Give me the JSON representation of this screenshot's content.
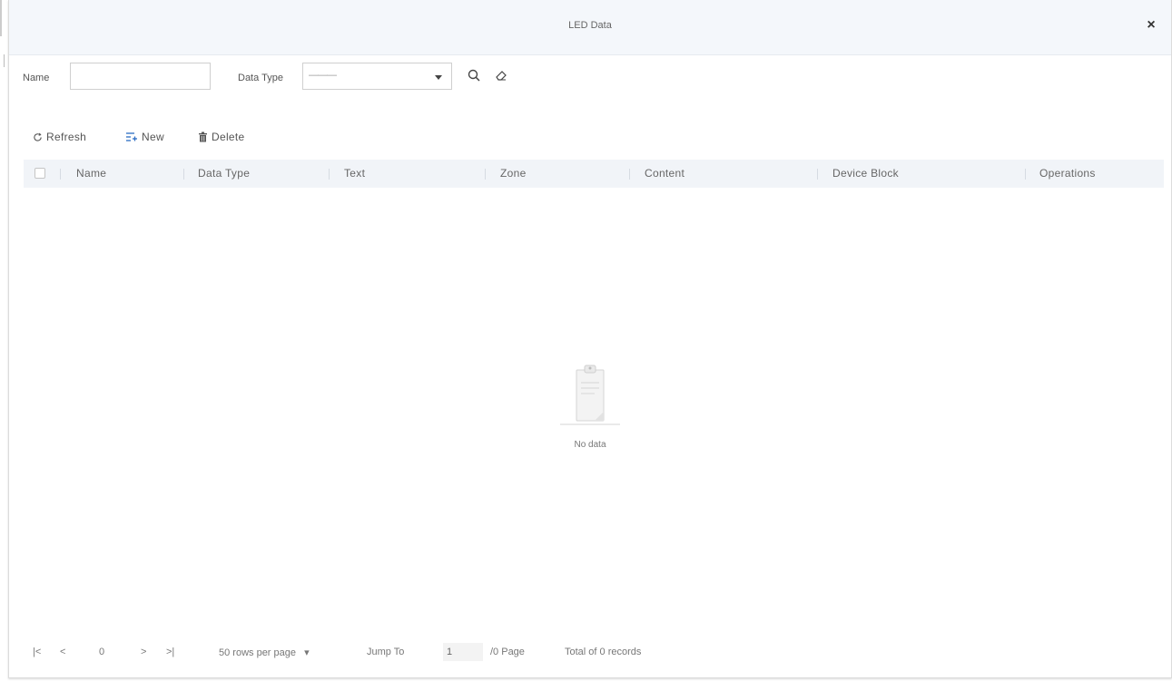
{
  "dialog": {
    "title": "LED Data",
    "close_symbol": "×"
  },
  "search": {
    "name_label": "Name",
    "name_value": "",
    "data_type_label": "Data Type",
    "data_type_value": "———",
    "search_icon": "search-icon",
    "clear_icon": "eraser-icon"
  },
  "toolbar": {
    "refresh": "Refresh",
    "new": "New",
    "delete": "Delete"
  },
  "table": {
    "columns": [
      "Name",
      "Data Type",
      "Text",
      "Zone",
      "Content",
      "Device Block",
      "Operations"
    ],
    "rows": []
  },
  "empty": {
    "text": "No data"
  },
  "pager": {
    "first": "|<",
    "prev": "<",
    "current_page": "0",
    "next": ">",
    "last": ">|",
    "rows_per_page": "50 rows per page",
    "jump_label": "Jump To",
    "jump_value": "1",
    "page_total": "/0 Page",
    "total_records": "Total of 0 records"
  }
}
